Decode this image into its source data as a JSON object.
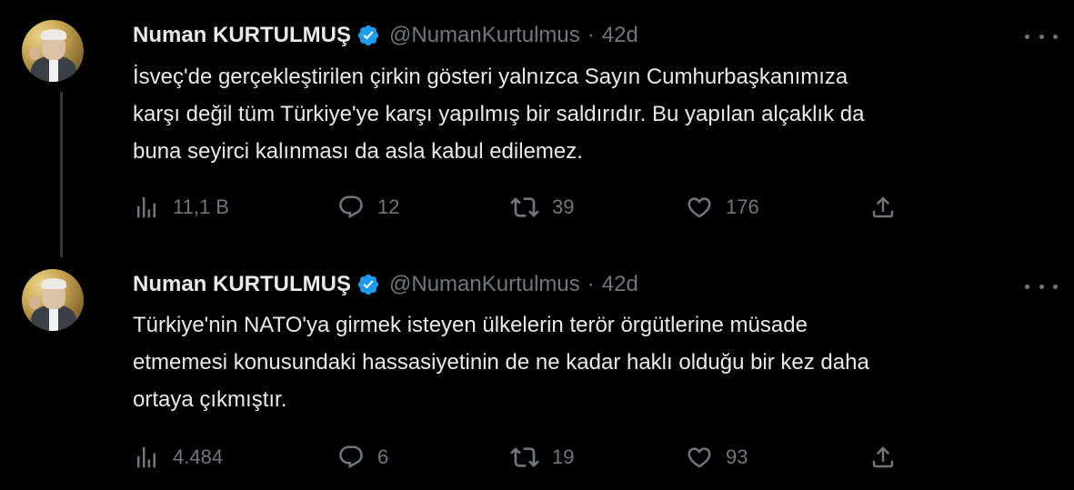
{
  "tweets": [
    {
      "author": {
        "name": "Numan KURTULMUŞ",
        "handle": "@NumanKurtulmus",
        "verified": true
      },
      "time": "42d",
      "text_lines": [
        "İsveç'de gerçekleştirilen çirkin gösteri yalnızca Sayın Cumhurbaşkanımıza",
        "karşı değil tüm Türkiye'ye karşı yapılmış bir saldırıdır. Bu yapılan alçaklık da",
        "buna seyirci kalınması da asla kabul edilemez."
      ],
      "stats": {
        "views": "11,1 B",
        "replies": "12",
        "retweets": "39",
        "likes": "176"
      }
    },
    {
      "author": {
        "name": "Numan KURTULMUŞ",
        "handle": "@NumanKurtulmus",
        "verified": true
      },
      "time": "42d",
      "text_lines": [
        "Türkiye'nin NATO'ya girmek isteyen ülkelerin terör örgütlerine müsade",
        "etmemesi konusundaki hassasiyetinin de ne kadar haklı olduğu bir kez daha",
        "ortaya çıkmıştır."
      ],
      "stats": {
        "views": "4.484",
        "replies": "6",
        "retweets": "19",
        "likes": "93"
      }
    }
  ],
  "separator": "·",
  "icons": {
    "verified": "verified-badge-icon",
    "more": "more-options-icon",
    "views": "analytics-icon",
    "reply": "reply-icon",
    "retweet": "retweet-icon",
    "like": "heart-icon",
    "share": "share-icon"
  },
  "colors": {
    "background": "#000000",
    "text": "#e7e9ea",
    "secondary": "#71767b",
    "verified": "#1d9bf0",
    "thread_line": "#333639"
  }
}
